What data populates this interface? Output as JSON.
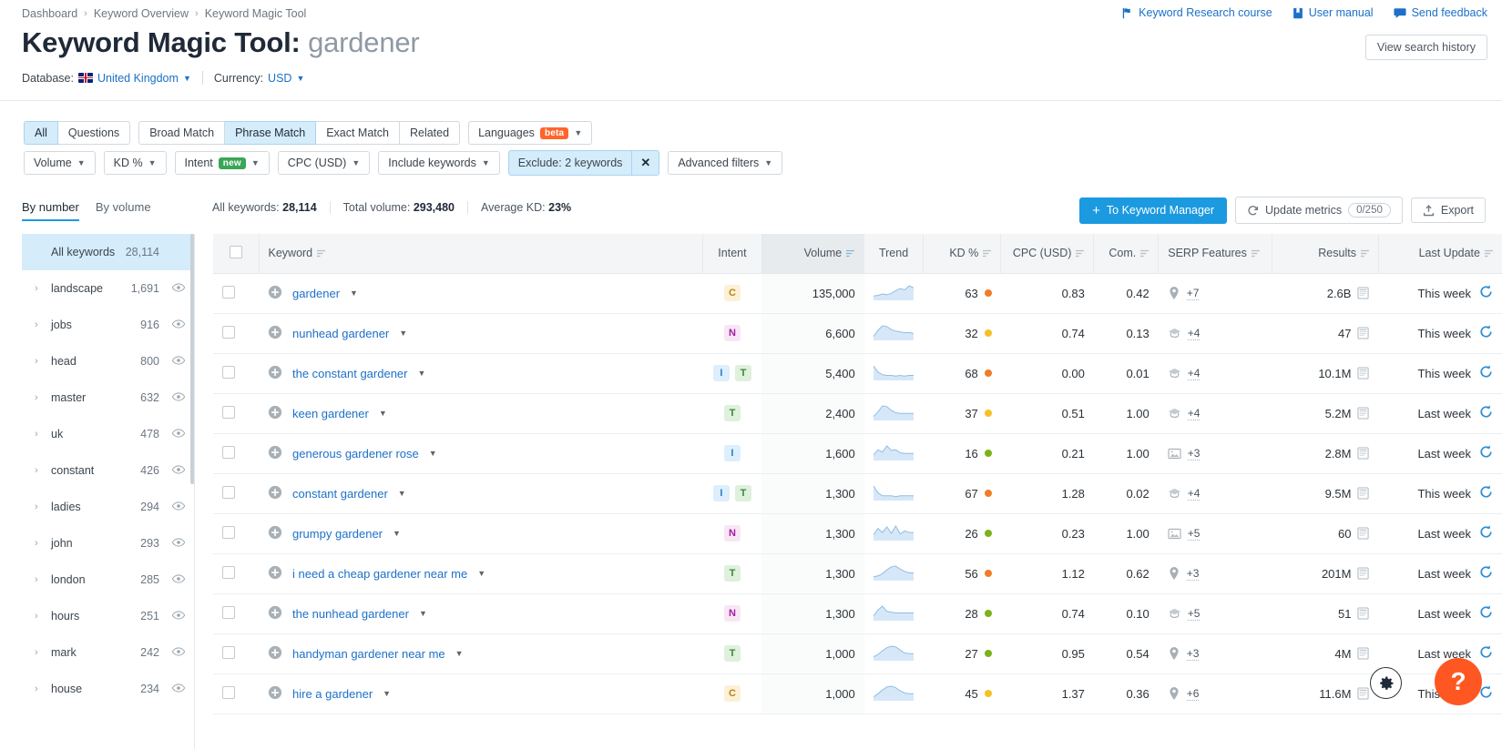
{
  "breadcrumb": [
    "Dashboard",
    "Keyword Overview",
    "Keyword Magic Tool"
  ],
  "top_links": [
    {
      "label": "Keyword Research course",
      "icon": "flag-icon"
    },
    {
      "label": "User manual",
      "icon": "book-icon"
    },
    {
      "label": "Send feedback",
      "icon": "comment-icon"
    }
  ],
  "title": {
    "prefix": "Keyword Magic Tool:",
    "query": "gardener"
  },
  "meta": {
    "database_label": "Database:",
    "database_value": "United Kingdom",
    "currency_label": "Currency:",
    "currency_value": "USD"
  },
  "view_history_label": "View search history",
  "match_tabs": [
    {
      "label": "All",
      "active": true
    },
    {
      "label": "Questions",
      "active": false
    }
  ],
  "match_types": [
    {
      "label": "Broad Match",
      "active": false
    },
    {
      "label": "Phrase Match",
      "active": true
    },
    {
      "label": "Exact Match",
      "active": false
    },
    {
      "label": "Related",
      "active": false
    }
  ],
  "languages": {
    "label": "Languages",
    "badge": "beta"
  },
  "filters": [
    {
      "label": "Volume",
      "badge": null,
      "active": false
    },
    {
      "label": "KD %",
      "badge": null,
      "active": false
    },
    {
      "label": "Intent",
      "badge": "new",
      "active": false
    },
    {
      "label": "CPC (USD)",
      "badge": null,
      "active": false
    },
    {
      "label": "Include keywords",
      "badge": null,
      "active": false
    }
  ],
  "exclude_filter": {
    "label": "Exclude: 2 keywords",
    "close": "✕"
  },
  "advanced_filters": {
    "label": "Advanced filters"
  },
  "sidebar": {
    "tabs": [
      {
        "label": "By number",
        "active": true
      },
      {
        "label": "By volume",
        "active": false
      }
    ],
    "items": [
      {
        "label": "All keywords",
        "count": "28,114",
        "selected": true,
        "eye": false
      },
      {
        "label": "landscape",
        "count": "1,691",
        "selected": false,
        "eye": true
      },
      {
        "label": "jobs",
        "count": "916",
        "selected": false,
        "eye": true
      },
      {
        "label": "head",
        "count": "800",
        "selected": false,
        "eye": true
      },
      {
        "label": "master",
        "count": "632",
        "selected": false,
        "eye": true
      },
      {
        "label": "uk",
        "count": "478",
        "selected": false,
        "eye": true
      },
      {
        "label": "constant",
        "count": "426",
        "selected": false,
        "eye": true
      },
      {
        "label": "ladies",
        "count": "294",
        "selected": false,
        "eye": true
      },
      {
        "label": "john",
        "count": "293",
        "selected": false,
        "eye": true
      },
      {
        "label": "london",
        "count": "285",
        "selected": false,
        "eye": true
      },
      {
        "label": "hours",
        "count": "251",
        "selected": false,
        "eye": true
      },
      {
        "label": "mark",
        "count": "242",
        "selected": false,
        "eye": true
      },
      {
        "label": "house",
        "count": "234",
        "selected": false,
        "eye": true
      }
    ]
  },
  "summary": {
    "all_keywords_label": "All keywords:",
    "all_keywords_value": "28,114",
    "total_volume_label": "Total volume:",
    "total_volume_value": "293,480",
    "average_kd_label": "Average KD:",
    "average_kd_value": "23%"
  },
  "actions": {
    "to_keyword_manager": "To Keyword Manager",
    "update_metrics": "Update metrics",
    "update_metrics_counter": "0/250",
    "export": "Export"
  },
  "table": {
    "columns": [
      {
        "key": "checkbox",
        "label": "",
        "align": "left"
      },
      {
        "key": "keyword",
        "label": "Keyword",
        "align": "left",
        "sortable": true
      },
      {
        "key": "intent",
        "label": "Intent",
        "align": "center",
        "sortable": false
      },
      {
        "key": "volume",
        "label": "Volume",
        "align": "right",
        "sortable": true,
        "sorted": true
      },
      {
        "key": "trend",
        "label": "Trend",
        "align": "center",
        "sortable": false
      },
      {
        "key": "kd",
        "label": "KD %",
        "align": "right",
        "sortable": true
      },
      {
        "key": "cpc",
        "label": "CPC (USD)",
        "align": "right",
        "sortable": true
      },
      {
        "key": "com",
        "label": "Com.",
        "align": "right",
        "sortable": true
      },
      {
        "key": "serp",
        "label": "SERP Features",
        "align": "left",
        "sortable": true
      },
      {
        "key": "results",
        "label": "Results",
        "align": "right",
        "sortable": true
      },
      {
        "key": "updated",
        "label": "Last Update",
        "align": "right",
        "sortable": true
      }
    ],
    "rows": [
      {
        "keyword": "gardener",
        "intent": [
          "C"
        ],
        "volume": "135,000",
        "trend": [
          5,
          6,
          8,
          7,
          9,
          13,
          16,
          14,
          20,
          17
        ],
        "kd": "63",
        "kd_color": "#f07c27",
        "cpc": "0.83",
        "com": "0.42",
        "serp_icon": "map-pin-icon",
        "serp_more": "+7",
        "results": "2.6B",
        "updated": "This week"
      },
      {
        "keyword": "nunhead gardener",
        "intent": [
          "N"
        ],
        "volume": "6,600",
        "trend": [
          4,
          12,
          18,
          17,
          13,
          11,
          10,
          9,
          9,
          8
        ],
        "kd": "32",
        "kd_color": "#f5c026",
        "cpc": "0.74",
        "com": "0.13",
        "serp_icon": "knowledge-icon",
        "serp_more": "+4",
        "results": "47",
        "updated": "This week"
      },
      {
        "keyword": "the constant gardener",
        "intent": [
          "I",
          "T"
        ],
        "volume": "5,400",
        "trend": [
          20,
          11,
          7,
          6,
          6,
          5,
          6,
          5,
          6,
          6
        ],
        "kd": "68",
        "kd_color": "#f07c27",
        "cpc": "0.00",
        "com": "0.01",
        "serp_icon": "knowledge-icon",
        "serp_more": "+4",
        "results": "10.1M",
        "updated": "This week"
      },
      {
        "keyword": "keen gardener",
        "intent": [
          "T"
        ],
        "volume": "2,400",
        "trend": [
          4,
          10,
          18,
          17,
          12,
          9,
          8,
          8,
          8,
          8
        ],
        "kd": "37",
        "kd_color": "#f5c026",
        "cpc": "0.51",
        "com": "1.00",
        "serp_icon": "knowledge-icon",
        "serp_more": "+4",
        "results": "5.2M",
        "updated": "Last week"
      },
      {
        "keyword": "generous gardener rose",
        "intent": [
          "I"
        ],
        "volume": "1,600",
        "trend": [
          6,
          13,
          10,
          18,
          12,
          13,
          9,
          8,
          8,
          8
        ],
        "kd": "16",
        "kd_color": "#7ab317",
        "cpc": "0.21",
        "com": "1.00",
        "serp_icon": "image-icon",
        "serp_more": "+3",
        "results": "2.8M",
        "updated": "Last week"
      },
      {
        "keyword": "constant gardener",
        "intent": [
          "I",
          "T"
        ],
        "volume": "1,300",
        "trend": [
          18,
          9,
          5,
          5,
          5,
          4,
          5,
          5,
          5,
          5
        ],
        "kd": "67",
        "kd_color": "#f07c27",
        "cpc": "1.28",
        "com": "0.02",
        "serp_icon": "knowledge-icon",
        "serp_more": "+4",
        "results": "9.5M",
        "updated": "This week"
      },
      {
        "keyword": "grumpy gardener",
        "intent": [
          "N"
        ],
        "volume": "1,300",
        "trend": [
          6,
          14,
          9,
          16,
          8,
          17,
          7,
          11,
          9,
          9
        ],
        "kd": "26",
        "kd_color": "#7ab317",
        "cpc": "0.23",
        "com": "1.00",
        "serp_icon": "image-icon",
        "serp_more": "+5",
        "results": "60",
        "updated": "Last week"
      },
      {
        "keyword": "i need a cheap gardener near me",
        "intent": [
          "T"
        ],
        "volume": "1,300",
        "trend": [
          4,
          5,
          8,
          13,
          17,
          18,
          14,
          11,
          9,
          9
        ],
        "kd": "56",
        "kd_color": "#f07c27",
        "cpc": "1.12",
        "com": "0.62",
        "serp_icon": "map-pin-icon",
        "serp_more": "+3",
        "results": "201M",
        "updated": "Last week"
      },
      {
        "keyword": "the nunhead gardener",
        "intent": [
          "N"
        ],
        "volume": "1,300",
        "trend": [
          5,
          13,
          18,
          11,
          10,
          9,
          9,
          9,
          9,
          9
        ],
        "kd": "28",
        "kd_color": "#7ab317",
        "cpc": "0.74",
        "com": "0.10",
        "serp_icon": "knowledge-icon",
        "serp_more": "+5",
        "results": "51",
        "updated": "Last week"
      },
      {
        "keyword": "handyman gardener near me",
        "intent": [
          "T"
        ],
        "volume": "1,000",
        "trend": [
          4,
          7,
          12,
          16,
          18,
          17,
          13,
          9,
          8,
          8
        ],
        "kd": "27",
        "kd_color": "#7ab317",
        "cpc": "0.95",
        "com": "0.54",
        "serp_icon": "map-pin-icon",
        "serp_more": "+3",
        "results": "4M",
        "updated": "Last week"
      },
      {
        "keyword": "hire a gardener",
        "intent": [
          "C"
        ],
        "volume": "1,000",
        "trend": [
          4,
          8,
          13,
          17,
          18,
          16,
          12,
          9,
          8,
          8
        ],
        "kd": "45",
        "kd_color": "#f5c026",
        "cpc": "1.37",
        "com": "0.36",
        "serp_icon": "map-pin-icon",
        "serp_more": "+6",
        "results": "11.6M",
        "updated": "This week"
      }
    ]
  },
  "fab": {
    "gear": "gear-icon",
    "help": "?"
  }
}
